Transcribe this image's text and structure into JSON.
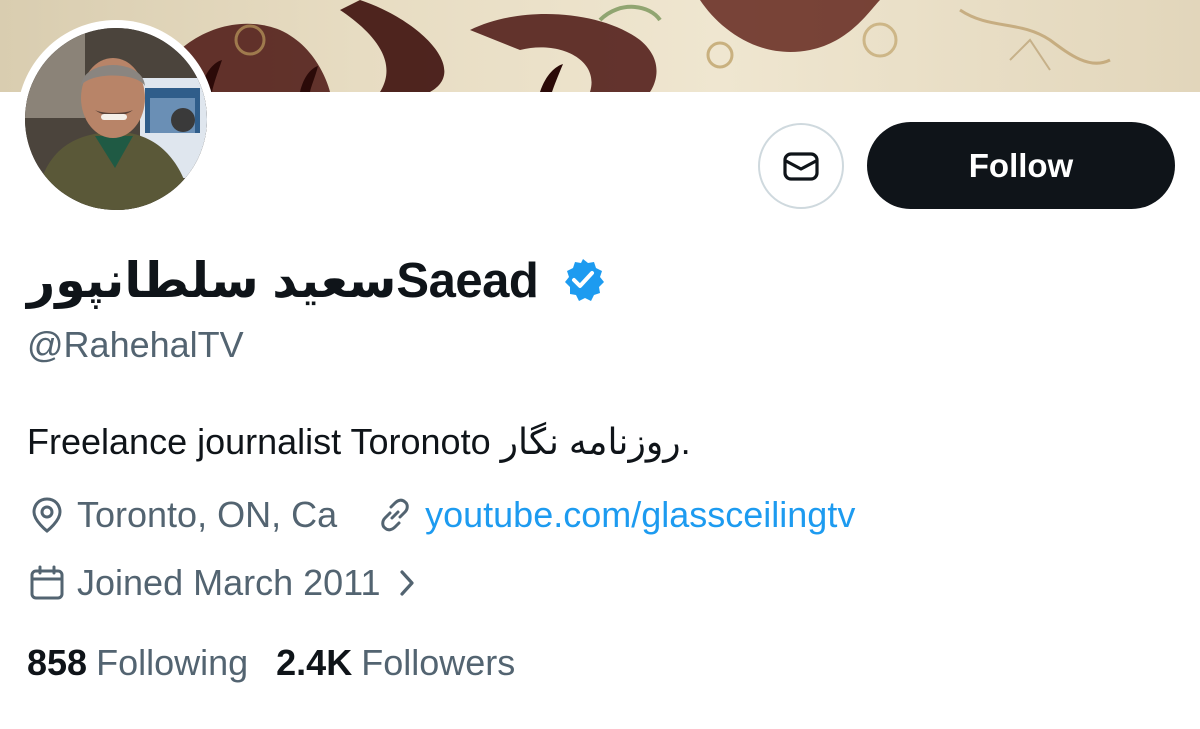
{
  "profile": {
    "display_name": "سعید سلطانپورSaead",
    "handle": "@RahehalTV",
    "bio": "Freelance journalist Toronoto روزنامه نگار.",
    "location": "Toronto, ON, Ca",
    "website": "youtube.com/glassceilingtv",
    "joined": "Joined March 2011",
    "verified": true,
    "icons": {
      "verified": "verified-badge-icon",
      "message": "envelope-icon",
      "location": "location-pin-icon",
      "link": "link-icon",
      "calendar": "calendar-icon",
      "chevron": "chevron-right-icon"
    }
  },
  "actions": {
    "follow_label": "Follow"
  },
  "stats": {
    "following_count": "858",
    "following_label": "Following",
    "followers_count": "2.4K",
    "followers_label": "Followers"
  },
  "colors": {
    "accent": "#1d9bf0",
    "text_primary": "#0f1419",
    "text_secondary": "#536471",
    "button_dark": "#0f1419",
    "border": "#cfd9de"
  }
}
